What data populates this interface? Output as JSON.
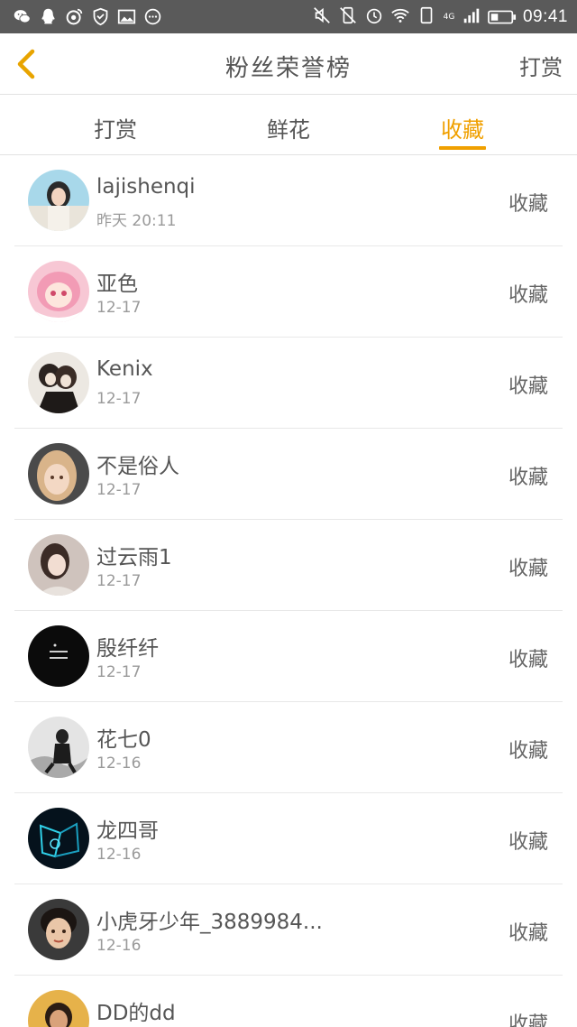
{
  "status_bar": {
    "time": "09:41",
    "network": "4G",
    "left_icons": [
      "wechat-icon",
      "qq-icon",
      "weibo-icon",
      "shield-icon",
      "gallery-icon",
      "more-icon"
    ],
    "right_icons": [
      "mute-icon",
      "vibrate-off-icon",
      "alarm-icon",
      "wifi-icon",
      "sim-icon",
      "signal-icon",
      "battery-icon"
    ]
  },
  "header": {
    "title": "粉丝荣誉榜",
    "action_label": "打赏",
    "back_icon": "chevron-left-icon",
    "back_color": "#e8a400"
  },
  "tabs": {
    "items": [
      {
        "label": "打赏"
      },
      {
        "label": "鲜花"
      },
      {
        "label": "收藏"
      }
    ],
    "active_index": 2,
    "active_color": "#f0a000"
  },
  "list": {
    "items": [
      {
        "name": "lajishenqi",
        "date": "昨天 20:11",
        "action": "收藏"
      },
      {
        "name": "亚色",
        "date": "12-17",
        "action": "收藏"
      },
      {
        "name": "Kenix",
        "date": "12-17",
        "action": "收藏"
      },
      {
        "name": "不是俗人",
        "date": "12-17",
        "action": "收藏"
      },
      {
        "name": "过云雨1",
        "date": "12-17",
        "action": "收藏"
      },
      {
        "name": "殷纤纤",
        "date": "12-17",
        "action": "收藏"
      },
      {
        "name": "花七0",
        "date": "12-16",
        "action": "收藏"
      },
      {
        "name": "龙四哥",
        "date": "12-16",
        "action": "收藏"
      },
      {
        "name": "小虎牙少年_3889984...",
        "date": "12-16",
        "action": "收藏"
      },
      {
        "name": "DD的dd",
        "date": "",
        "action": "收藏"
      }
    ]
  }
}
